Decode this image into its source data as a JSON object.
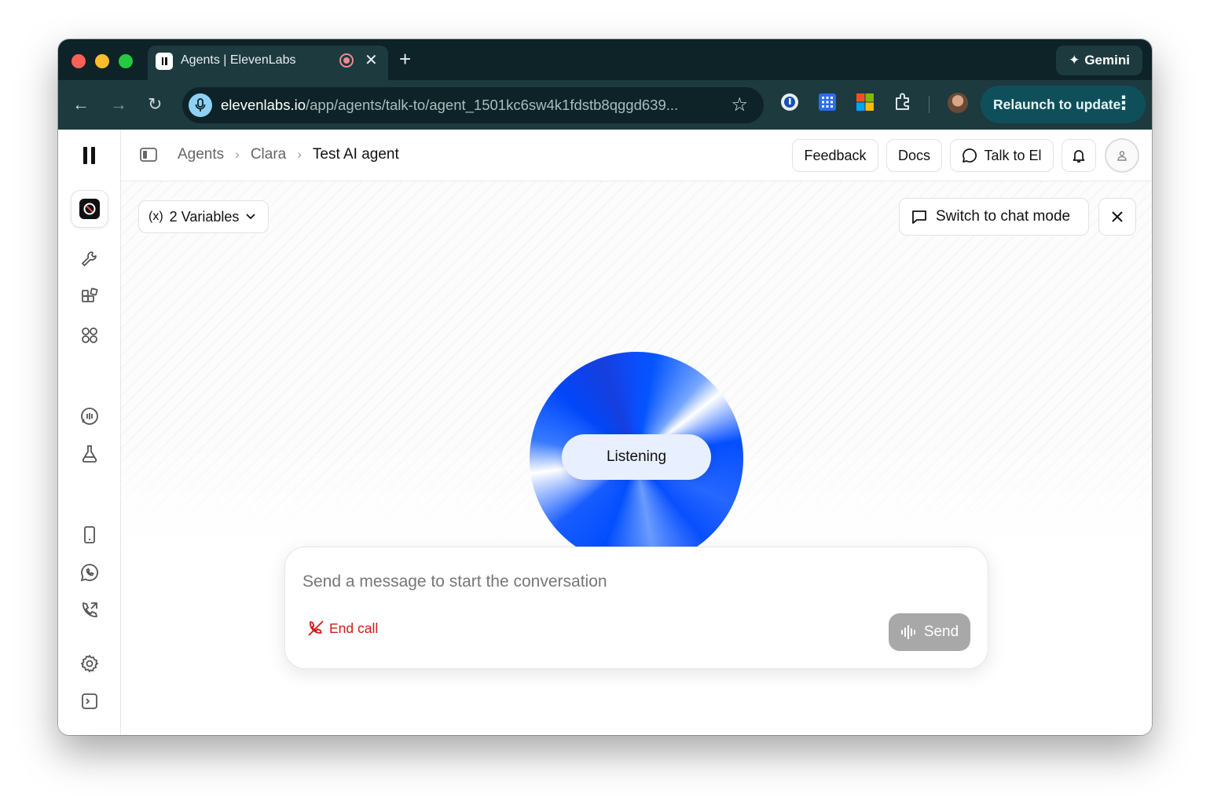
{
  "browser": {
    "tab_title": "Agents | ElevenLabs",
    "url_host": "elevenlabs.io",
    "url_path": "/app/agents/talk-to/agent_1501kc6sw4k1fdstb8qggd639...",
    "gemini_label": "Gemini",
    "relaunch_label": "Relaunch to update"
  },
  "header": {
    "breadcrumbs": [
      "Agents",
      "Clara",
      "Test AI agent"
    ],
    "buttons": {
      "feedback": "Feedback",
      "docs": "Docs",
      "talk": "Talk to El"
    }
  },
  "main": {
    "variables_label": "2 Variables",
    "switch_label": "Switch to chat mode",
    "orb_status": "Listening",
    "composer": {
      "placeholder": "Send a message to start the conversation",
      "end_call": "End call",
      "send": "Send"
    }
  },
  "colors": {
    "accent_blue": "#0a4ff5",
    "end_call_red": "#d11a1a",
    "chrome_dark": "#0e2327"
  },
  "sidebar_icons": [
    "agent-icon",
    "wrench-icon",
    "integrations-icon",
    "apps-icon",
    "conversations-icon",
    "tests-icon",
    "phone-icon",
    "whatsapp-icon",
    "outbound-call-icon",
    "settings-icon",
    "terminal-icon"
  ]
}
